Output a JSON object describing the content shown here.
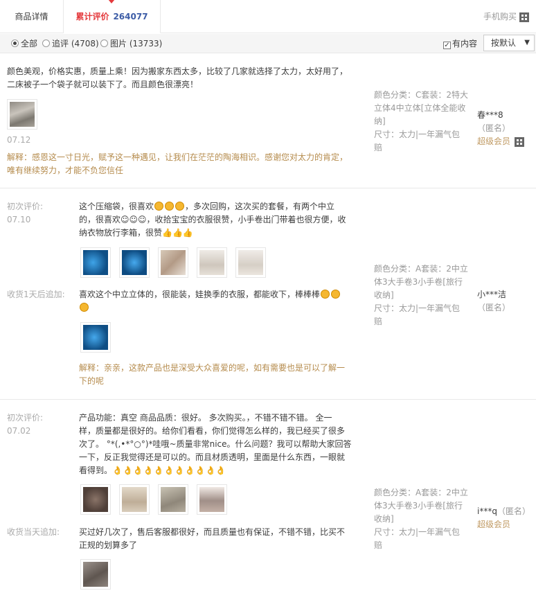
{
  "tabs": {
    "detail": "商品详情",
    "reviews_label": "累计评价",
    "reviews_count": "264077",
    "mobile_buy": "手机购买"
  },
  "filter": {
    "all": "全部",
    "append": "追评 (4708)",
    "pics": "图片 (13733)",
    "has_content": "有内容",
    "sort": "按默认"
  },
  "colors": {
    "accent": "#e4393c",
    "count": "#3c5ca6",
    "reply": "#b58b4c"
  },
  "reviews": [
    {
      "content_line1": "颜色美观，价格实惠，质量上乘！因为搬家东西太多，比较了几家就选择了太力，太好用了，",
      "content_line2": "二床被子一个袋子就可以装下了。而且颜色很漂亮！",
      "date": "07.12",
      "reply_line1": "解释：感恩这一寸日光，赋予这一种遇见，让我们在茫茫的陶海相识。感谢您对太力的肯定，",
      "reply_line2": "唯有继续努力，才能不负您信任",
      "sku_color_line1": "颜色分类：C套装：2特大",
      "sku_color_line2": "立体4中立体[立体全能收",
      "sku_color_line3": "纳]",
      "sku_size_line1": "尺寸：太力|一年漏气包",
      "sku_size_line2": "赔",
      "user": "春***8",
      "anon": "（匿名）",
      "vip": "超级会员"
    },
    {
      "initial_label": "初次评价:",
      "date": "07.10",
      "content_line1": "这个压缩袋，很喜欢",
      "content_line1b": "，多次回购，这次买的套餐，有两个中立",
      "content_line2": "的，很喜欢☺☺☺，收拾宝宝的衣服很赞，小手卷出门带着也很方便，收",
      "content_line3": "纳衣物放行李箱，很赞👍👍👍",
      "append_label": "收货1天后追加:",
      "append_line1": "喜欢这个中立立体的，很能装，娃换季的衣服，都能收下，棒棒棒",
      "reply_line1": "解释：亲亲，这款产品也是深受大众喜爱的呢，如有需要也是可以了解一",
      "reply_line2": "下的呢",
      "sku_color_line1": "颜色分类：A套装：2中立",
      "sku_color_line2": "体3大手卷3小手卷[旅行",
      "sku_color_line3": "收纳]",
      "sku_size_line1": "尺寸：太力|一年漏气包",
      "sku_size_line2": "赔",
      "user": "小***洁",
      "anon": "（匿名）"
    },
    {
      "initial_label": "初次评价:",
      "date": "07.02",
      "content_line1": "产品功能：真空 商品品质：很好。 多次购买。，不错不错不错。 全一",
      "content_line2": "样，质量都是很好的。给你们看看，你们觉得怎么样的，我已经买了很多",
      "content_line3": "次了。 °*(,•*°○°)*哇哦~质量非常nice。什么问题？我可以帮助大家回答",
      "content_line4": "一下，反正我觉得还是可以的。而且材质透明，里面是什么东西，一眼就",
      "content_line5": "看得到。👌👌👌👌👌👌👌👌👌👌👌",
      "append_label": "收货当天追加:",
      "append_line1": "买过好几次了，售后客服都很好，而且质量也有保证，不错不错，比买不",
      "append_line2": "正规的划算多了",
      "sku_color_line1": "颜色分类：A套装：2中立",
      "sku_color_line2": "体3大手卷3小手卷[旅行",
      "sku_color_line3": "收纳]",
      "sku_size_line1": "尺寸：太力|一年漏气包",
      "sku_size_line2": "赔",
      "user": "i***q",
      "anon": "（匿名）",
      "vip": "超级会员"
    }
  ]
}
